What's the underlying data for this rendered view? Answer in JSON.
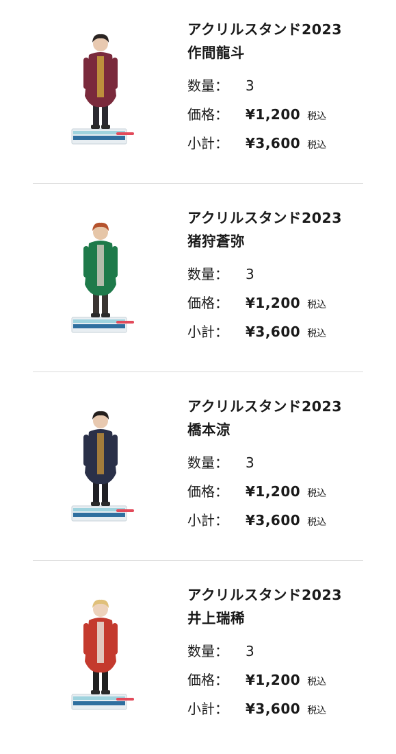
{
  "items": [
    {
      "title": "アクリルスタンド2023",
      "member": "作間龍斗",
      "quantity_label": "数量：",
      "quantity": "3",
      "price_label": "価格：",
      "price": "¥1,200",
      "subtotal_label": "小計：",
      "subtotal": "¥3,600",
      "tax_note": "税込",
      "colors": {
        "top": "#7a2a3c",
        "bottom": "#2b2a30",
        "accent": "#c9a23c",
        "skin": "#e8c9b0",
        "hair": "#2a2422"
      }
    },
    {
      "title": "アクリルスタンド2023",
      "member": "猪狩蒼弥",
      "quantity_label": "数量：",
      "quantity": "3",
      "price_label": "価格：",
      "price": "¥1,200",
      "subtotal_label": "小計：",
      "subtotal": "¥3,600",
      "tax_note": "税込",
      "colors": {
        "top": "#1e7a4a",
        "bottom": "#3a3532",
        "accent": "#cfc8bc",
        "skin": "#e6c6a8",
        "hair": "#b5532e"
      }
    },
    {
      "title": "アクリルスタンド2023",
      "member": "橋本涼",
      "quantity_label": "数量：",
      "quantity": "3",
      "price_label": "価格：",
      "price": "¥1,200",
      "subtotal_label": "小計：",
      "subtotal": "¥3,600",
      "tax_note": "税込",
      "colors": {
        "top": "#2a3048",
        "bottom": "#1f1f24",
        "accent": "#b88a3a",
        "skin": "#e8c9b0",
        "hair": "#231e1c"
      }
    },
    {
      "title": "アクリルスタンド2023",
      "member": "井上瑞稀",
      "quantity_label": "数量：",
      "quantity": "3",
      "price_label": "価格：",
      "price": "¥1,200",
      "subtotal_label": "小計：",
      "subtotal": "¥3,600",
      "tax_note": "税込",
      "colors": {
        "top": "#c43a2e",
        "bottom": "#202020",
        "accent": "#e7e2d8",
        "skin": "#edd2bb",
        "hair": "#e0c07a"
      }
    }
  ],
  "stand_colors": {
    "base_top": "#9fd3de",
    "base_mid": "#2f6f9f",
    "base_accent": "#e24a5a",
    "base_light": "#e8eef2"
  }
}
